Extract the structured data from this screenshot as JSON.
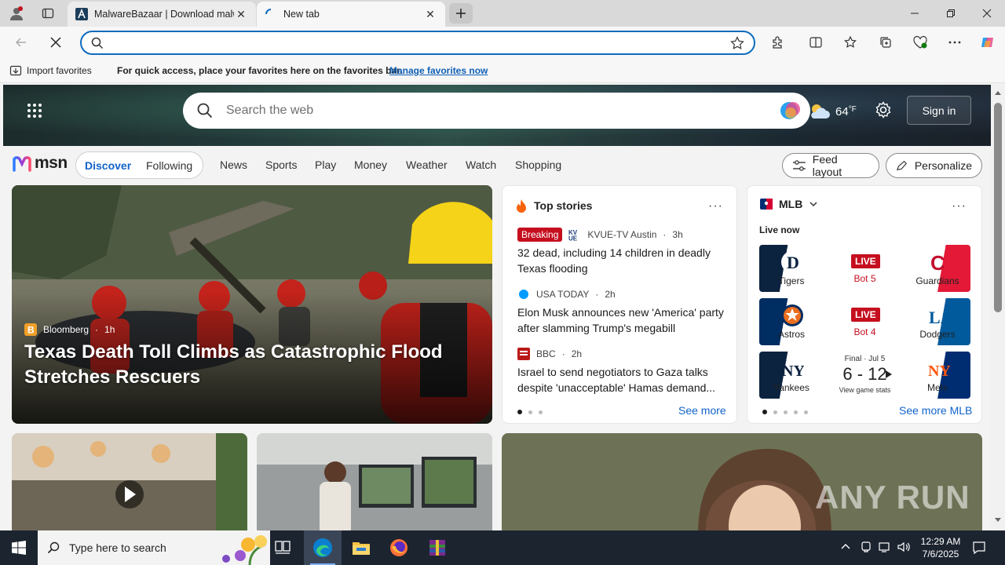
{
  "browser": {
    "tabs": [
      {
        "title": "MalwareBazaar | Download malware samples",
        "active": false
      },
      {
        "title": "New tab",
        "active": true
      }
    ],
    "address": {
      "value": "",
      "placeholder": ""
    },
    "favorites_bar": {
      "import_label": "Import favorites",
      "message": "For quick access, place your favorites here on the favorites bar.",
      "manage_link": "Manage favorites now"
    }
  },
  "msn": {
    "search_placeholder": "Search the web",
    "weather": {
      "temp": "64",
      "unit": "°F"
    },
    "sign_in": "Sign in",
    "logo_text": "msn",
    "pill": {
      "discover": "Discover",
      "following": "Following"
    },
    "nav": [
      "News",
      "Sports",
      "Play",
      "Money",
      "Weather",
      "Watch",
      "Shopping"
    ],
    "feed_layout": "Feed layout",
    "personalize": "Personalize",
    "hero": {
      "source": "Bloomberg",
      "age": "1h",
      "headline": "Texas Death Toll Climbs as Catastrophic Flood Stretches Rescuers"
    },
    "top_stories": {
      "title": "Top stories",
      "items": [
        {
          "badge": "Breaking",
          "source": "KVUE-TV Austin",
          "age": "3h",
          "title": "32 dead, including 14 children in deadly Texas flooding"
        },
        {
          "source": "USA TODAY",
          "age": "2h",
          "title": "Elon Musk announces new 'America' party after slamming Trump's megabill"
        },
        {
          "source": "BBC",
          "age": "2h",
          "title": "Israel to send negotiators to Gaza talks despite 'unacceptable' Hamas demand..."
        }
      ],
      "see_more": "See more"
    },
    "mlb": {
      "title": "MLB",
      "live_now": "Live now",
      "games": [
        {
          "home": "Tigers",
          "away": "Guardians",
          "status": "LIVE",
          "inning": "Bot 5",
          "home_color": "#0c2340",
          "away_color": "#e31937"
        },
        {
          "home": "Astros",
          "away": "Dodgers",
          "status": "LIVE",
          "inning": "Bot 4",
          "home_color": "#eb6e1f",
          "away_color": "#005a9c"
        },
        {
          "home": "Yankees",
          "away": "Mets",
          "final": "Final · Jul 5",
          "score": "6 - 12",
          "stats": "View game stats",
          "home_color": "#0c2340",
          "away_color": "#ff5910"
        }
      ],
      "see_more": "See more MLB"
    }
  },
  "taskbar": {
    "search_placeholder": "Type here to search",
    "time": "12:29 AM",
    "date": "7/6/2025"
  },
  "watermark": "ANY RUN"
}
